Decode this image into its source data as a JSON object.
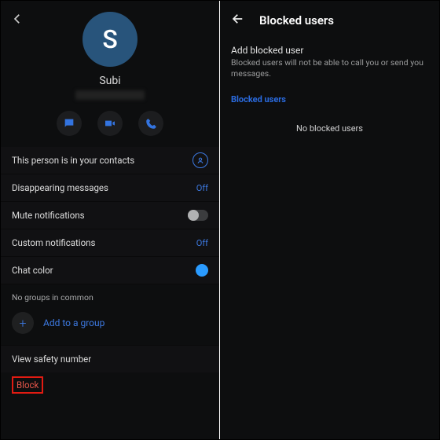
{
  "left": {
    "avatar_letter": "S",
    "name": "Subi",
    "rows": {
      "in_contacts": "This person is in your contacts",
      "disappearing": "Disappearing messages",
      "disappearing_val": "Off",
      "mute": "Mute notifications",
      "custom": "Custom notifications",
      "custom_val": "Off",
      "chat_color": "Chat color"
    },
    "groups_head": "No groups in common",
    "add_group": "Add to a group",
    "view_safety": "View safety number",
    "block": "Block"
  },
  "right": {
    "title": "Blocked users",
    "add_title": "Add blocked user",
    "add_sub": "Blocked users will not be able to call you or send you messages.",
    "section": "Blocked users",
    "empty": "No blocked users"
  }
}
